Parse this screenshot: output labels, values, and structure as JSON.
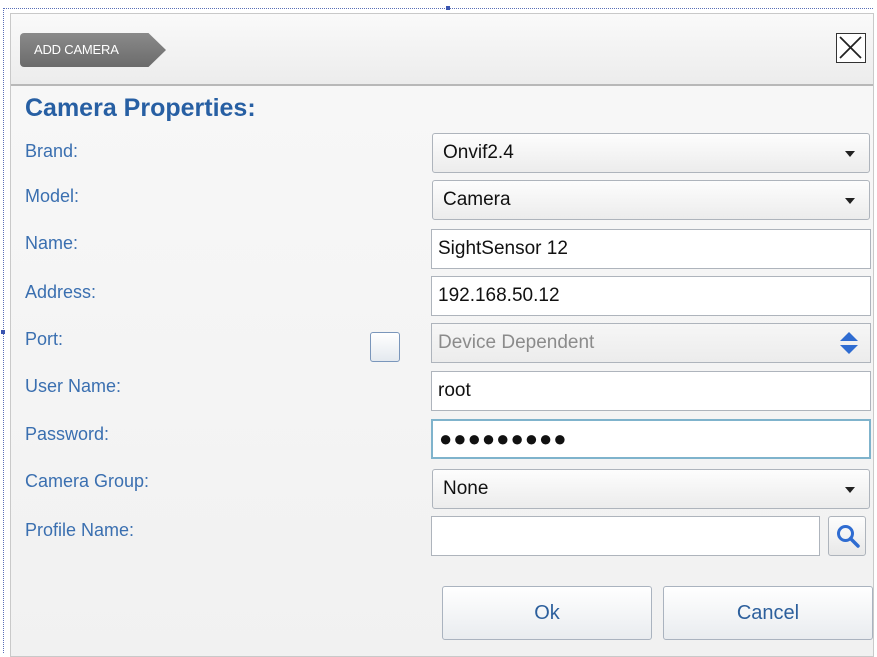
{
  "dialog": {
    "tab_label": "ADD CAMERA",
    "close_icon": "close-icon",
    "section_title": "Camera Properties:"
  },
  "form": {
    "brand": {
      "label": "Brand:",
      "value": "Onvif2.4"
    },
    "model": {
      "label": "Model:",
      "value": "Camera"
    },
    "name": {
      "label": "Name:",
      "value": "SightSensor 12"
    },
    "address": {
      "label": "Address:",
      "value": "192.168.50.12"
    },
    "port": {
      "label": "Port:",
      "value": "Device Dependent",
      "checked": false
    },
    "user_name": {
      "label": "User Name:",
      "value": "root"
    },
    "password": {
      "label": "Password:",
      "masked_value": "●●●●●●●●●"
    },
    "camera_group": {
      "label": "Camera Group:",
      "value": "None"
    },
    "profile_name": {
      "label": "Profile Name:",
      "value": "",
      "search_icon": "search-icon"
    }
  },
  "buttons": {
    "ok": "Ok",
    "cancel": "Cancel"
  },
  "colors": {
    "label_blue": "#3a6fb0",
    "title_blue": "#275fa3",
    "button_text": "#2c5f9c"
  }
}
